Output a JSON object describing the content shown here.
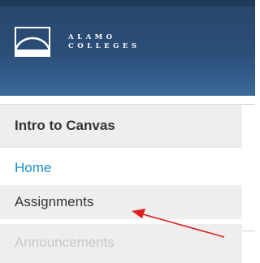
{
  "header": {
    "logo_line1": "ALAMO",
    "logo_line2": "COLLEGES",
    "logo_icon": "arch-logo-icon",
    "background_color": "#2b4e78"
  },
  "course": {
    "title": "Intro to Canvas"
  },
  "nav": {
    "items": [
      {
        "label": "Home",
        "state": "link"
      },
      {
        "label": "Assignments",
        "state": "highlighted"
      },
      {
        "label": "Announcements",
        "state": "disabled"
      }
    ]
  },
  "annotation": {
    "arrow_color": "#e02020",
    "arrow_icon": "red-arrow-icon"
  },
  "colors": {
    "link": "#1a8fc9",
    "text": "#333333",
    "muted": "#c8c8c8",
    "panel": "#eeeeee"
  }
}
